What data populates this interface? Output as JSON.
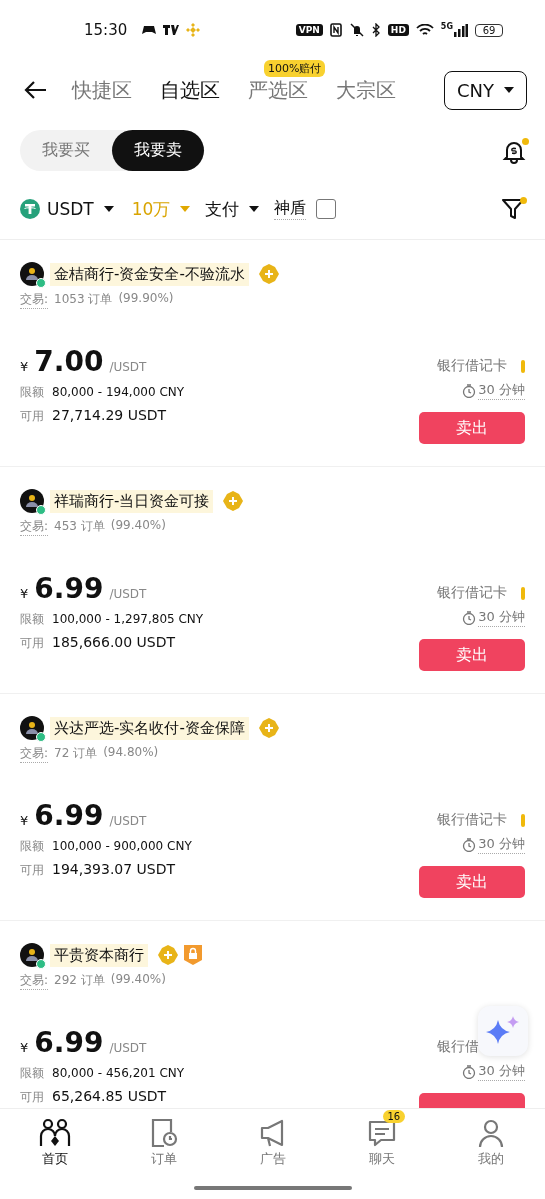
{
  "status_bar": {
    "time": "15:30",
    "vpn": "VPN",
    "hd": "HD",
    "network": "5G",
    "battery": "69"
  },
  "header": {
    "tabs": [
      {
        "label": "快捷区",
        "selected": false
      },
      {
        "label": "自选区",
        "selected": true
      },
      {
        "label": "严选区",
        "selected": false,
        "badge": "100%赔付"
      },
      {
        "label": "大宗区",
        "selected": false
      }
    ],
    "currency": "CNY"
  },
  "side_toggle": [
    {
      "label": "我要买",
      "selected": false
    },
    {
      "label": "我要卖",
      "selected": true
    }
  ],
  "alerts_dot": true,
  "filters": {
    "coin": "USDT",
    "amount": "10万",
    "payment": "支付",
    "shield": {
      "label": "神盾",
      "checked": false
    },
    "filter_dot": true
  },
  "ads": [
    {
      "name": "金桔商行-资金安全-不验流水",
      "online": true,
      "badges": [
        {
          "kind": "crown"
        }
      ],
      "trade_label": "交易:",
      "orders": "1053 订单",
      "rate": "(99.90%)",
      "currency_sign": "¥",
      "price": "7.00",
      "unit": "/USDT",
      "limit_label": "限额",
      "limit": "80,000 - 194,000 CNY",
      "available_label": "可用",
      "available": "27,714.29 USDT",
      "payment": "银行借记卡",
      "indicator": true,
      "time": "30 分钟",
      "action": "卖出"
    },
    {
      "name": "祥瑞商行-当日资金可接",
      "online": true,
      "badges": [
        {
          "kind": "crown"
        }
      ],
      "trade_label": "交易:",
      "orders": "453 订单",
      "rate": "(99.40%)",
      "currency_sign": "¥",
      "price": "6.99",
      "unit": "/USDT",
      "limit_label": "限额",
      "limit": "100,000 - 1,297,805 CNY",
      "available_label": "可用",
      "available": "185,666.00 USDT",
      "payment": "银行借记卡",
      "indicator": true,
      "time": "30 分钟",
      "action": "卖出"
    },
    {
      "name": "兴达严选-实名收付-资金保障",
      "online": true,
      "badges": [
        {
          "kind": "crown"
        }
      ],
      "trade_label": "交易:",
      "orders": "72 订单",
      "rate": "(94.80%)",
      "currency_sign": "¥",
      "price": "6.99",
      "unit": "/USDT",
      "limit_label": "限额",
      "limit": "100,000 - 900,000 CNY",
      "available_label": "可用",
      "available": "194,393.07 USDT",
      "payment": "银行借记卡",
      "indicator": true,
      "time": "30 分钟",
      "action": "卖出"
    },
    {
      "name": "平贵资本商行",
      "online": true,
      "badges": [
        {
          "kind": "crown"
        },
        {
          "kind": "shield"
        }
      ],
      "trade_label": "交易:",
      "orders": "292 订单",
      "rate": "(99.40%)",
      "currency_sign": "¥",
      "price": "6.99",
      "unit": "/USDT",
      "limit_label": "限额",
      "limit": "80,000 - 456,201 CNY",
      "available_label": "可用",
      "available": "65,264.85 USDT",
      "payment": "银行借",
      "indicator": false,
      "time": "30 分钟"
    }
  ],
  "bottom_nav": [
    {
      "label": "首页",
      "selected": true,
      "kind": "home"
    },
    {
      "label": "订单",
      "selected": false,
      "kind": "orders"
    },
    {
      "label": "广告",
      "selected": false,
      "kind": "ads"
    },
    {
      "label": "聊天",
      "selected": false,
      "kind": "chat",
      "badge": "16"
    },
    {
      "label": "我的",
      "selected": false,
      "kind": "profile"
    }
  ]
}
